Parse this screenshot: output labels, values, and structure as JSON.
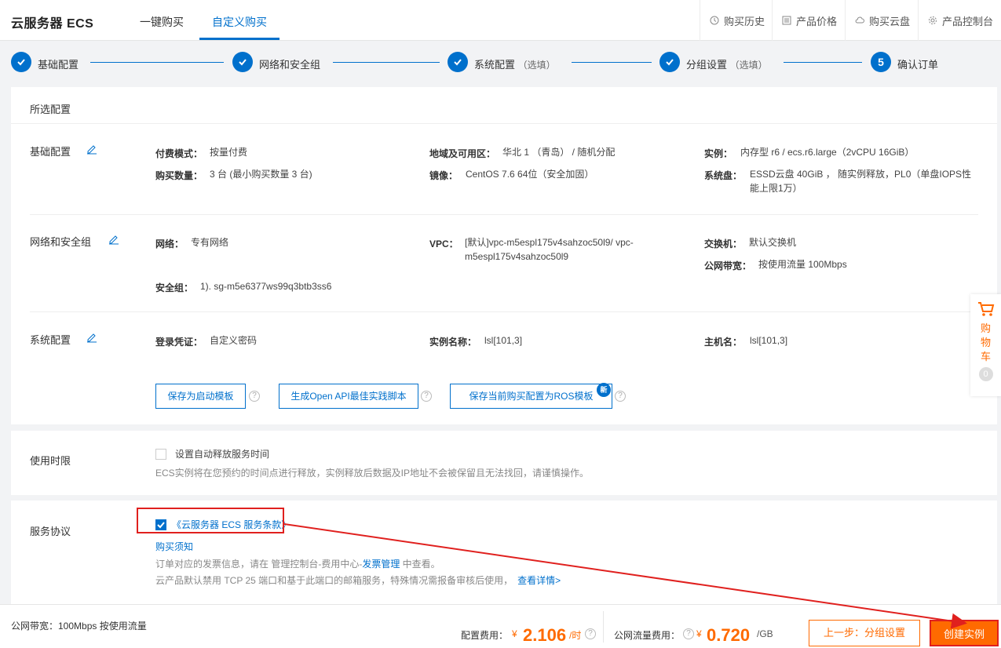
{
  "header": {
    "logo": "云服务器 ECS",
    "tabs": [
      {
        "label": "一键购买"
      },
      {
        "label": "自定义购买"
      }
    ],
    "nav": [
      {
        "label": "购买历史",
        "icon": "clock-icon"
      },
      {
        "label": "产品价格",
        "icon": "price-list-icon"
      },
      {
        "label": "购买云盘",
        "icon": "cloud-disk-icon"
      },
      {
        "label": "产品控制台",
        "icon": "gear-icon"
      }
    ]
  },
  "steps": [
    {
      "label": "基础配置",
      "opt": "",
      "state": "done"
    },
    {
      "label": "网络和安全组",
      "opt": "",
      "state": "done"
    },
    {
      "label": "系统配置",
      "opt": "（选填）",
      "state": "done"
    },
    {
      "label": "分组设置",
      "opt": "（选填）",
      "state": "done"
    },
    {
      "label": "确认订单",
      "opt": "",
      "num": "5",
      "state": "current"
    }
  ],
  "config": {
    "title": "所选配置",
    "basic": {
      "title": "基础配置",
      "pay_mode_label": "付费模式：",
      "pay_mode": "按量付费",
      "region_label": "地域及可用区：",
      "region": "华北 1 （青岛） / 随机分配",
      "instance_label": "实例：",
      "instance": "内存型 r6 / ecs.r6.large（2vCPU 16GiB）",
      "count_label": "购买数量：",
      "count": "3 台 (最小购买数量 3 台)",
      "image_label": "镜像：",
      "image": "CentOS 7.6 64位（安全加固）",
      "disk_label": "系统盘：",
      "disk_line1": "ESSD云盘 40GiB ， 随实例释放，PL0（单盘IOPS性",
      "disk_line2": "能上限1万）"
    },
    "network": {
      "title": "网络和安全组",
      "net_label": "网络：",
      "net": "专有网络",
      "vpc_label": "VPC：",
      "vpc_line1": "[默认]vpc-m5espl175v4sahzoc50l9/ vpc-",
      "vpc_line2": "m5espl175v4sahzoc50l9",
      "switch_label": "交换机：",
      "switch": "默认交换机",
      "bandwidth_label": "公网带宽：",
      "bandwidth": "按使用流量 100Mbps",
      "sg_label": "安全组：",
      "sg": "1). sg-m5e6377ws99q3btb3ss6"
    },
    "system": {
      "title": "系统配置",
      "login_label": "登录凭证：",
      "login": "自定义密码",
      "name_label": "实例名称：",
      "name": "lsl[101,3]",
      "host_label": "主机名：",
      "host": "lsl[101,3]"
    },
    "buttons": {
      "save_template": "保存为启动模板",
      "gen_api": "生成Open API最佳实践脚本",
      "save_ros": "保存当前购买配置为ROS模板",
      "new_badge": "新",
      "help": "?"
    }
  },
  "duration": {
    "title": "使用时限",
    "checkbox_label": "设置自动释放服务时间",
    "note": "ECS实例将在您预约的时间点进行释放，实例释放后数据及IP地址不会被保留且无法找回，请谨慎操作。"
  },
  "agreement": {
    "title": "服务协议",
    "terms_link": "《云服务器 ECS 服务条款》",
    "purchase_notice": "购买须知",
    "invoice_prefix": "订单对应的发票信息，请在 管理控制台-费用中心-",
    "invoice_link": "发票管理",
    "invoice_suffix": " 中查看。",
    "port_note": "云产品默认禁用 TCP 25 端口和基于此端口的邮箱服务，特殊情况需报备审核后使用，",
    "port_link": "查看详情>"
  },
  "cart": {
    "label": "购物车",
    "count": "0"
  },
  "footer": {
    "bandwidth": "公网带宽：100Mbps 按使用流量",
    "config_fee_label": "配置费用：",
    "currency": "¥",
    "config_fee": "2.106",
    "config_unit": "/时",
    "traffic_fee_label": "公网流量费用：",
    "traffic_fee": "0.720",
    "traffic_unit": "/GB",
    "prev_button": "上一步：分组设置",
    "create_button": "创建实例"
  },
  "colors": {
    "primary": "#0070cc",
    "accent": "#ff6a00",
    "annotation": "#e0201e"
  }
}
